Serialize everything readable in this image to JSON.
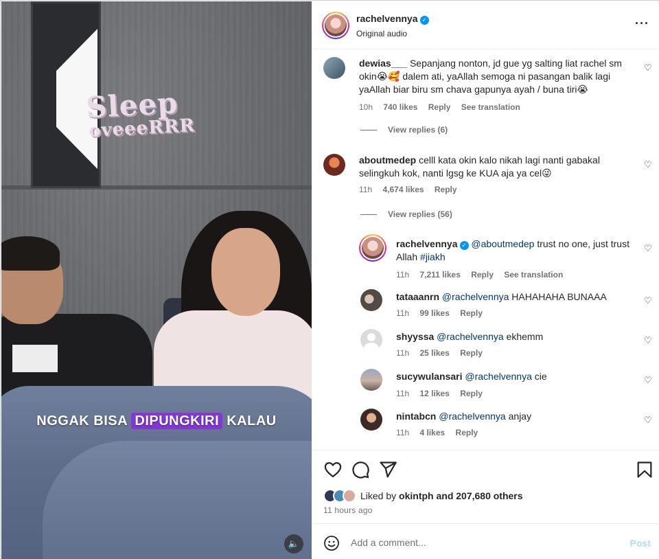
{
  "media": {
    "sticker_line1": "Sleep",
    "sticker_line2": "oveeeRRR",
    "caption_pre": "NGGAK BISA ",
    "caption_highlight": "DIPUNGKIRI",
    "caption_post": " KALAU",
    "audio_icon": "speaker-icon"
  },
  "header": {
    "username": "rachelvennya",
    "subtitle": "Original audio",
    "more_icon": "more-options-icon"
  },
  "comments": [
    {
      "username": "dewias___",
      "text": "Sepanjang nonton, jd gue yg salting liat rachel sm okin😭🥰 dalem ati, yaAllah semoga ni pasangan balik lagi yaAllah biar biru sm chava gapunya ayah / buna tiri😭",
      "time": "10h",
      "likes": "740 likes",
      "reply": "Reply",
      "translate": "See translation",
      "view_replies": "View replies (6)"
    },
    {
      "username": "aboutmedep",
      "text": "celll kata okin kalo nikah lagi nanti gabakal selingkuh kok, nanti lgsg ke KUA aja ya cel😜",
      "time": "11h",
      "likes": "4,674 likes",
      "reply": "Reply",
      "view_replies": "View replies (56)"
    }
  ],
  "replies": [
    {
      "username": "rachelvennya",
      "mention": "@aboutmedep",
      "text": " trust no one, just trust Allah ",
      "hashtag": "#jiakh",
      "time": "11h",
      "likes": "7,211 likes",
      "reply": "Reply",
      "translate": "See translation"
    },
    {
      "username": "tataaanrn",
      "mention": "@rachelvennya",
      "text": " HAHAHAHA BUNAAA",
      "time": "11h",
      "likes": "99 likes",
      "reply": "Reply"
    },
    {
      "username": "shyyssa",
      "mention": "@rachelvennya",
      "text": " ekhemm",
      "time": "11h",
      "likes": "25 likes",
      "reply": "Reply"
    },
    {
      "username": "sucywulansari",
      "mention": "@rachelvennya",
      "text": " cie",
      "time": "11h",
      "likes": "12 likes",
      "reply": "Reply"
    },
    {
      "username": "nintabcn",
      "mention": "@rachelvennya",
      "text": " anjay",
      "time": "11h",
      "likes": "4 likes",
      "reply": "Reply"
    }
  ],
  "actions": {
    "like_icon": "heart-icon",
    "comment_icon": "comment-icon",
    "share_icon": "paper-plane-icon",
    "save_icon": "bookmark-icon",
    "liked_by_prefix": "Liked by ",
    "liked_by_user": "okintph",
    "liked_by_suffix": " and 207,680 others",
    "time_ago": "11 hours ago"
  },
  "add_comment": {
    "placeholder": "Add a comment...",
    "post_label": "Post"
  },
  "colors": {
    "accent": "#0095f6",
    "mention": "#00376b",
    "caption_highlight": "#8437d6",
    "post_disabled": "#b3dbff"
  }
}
